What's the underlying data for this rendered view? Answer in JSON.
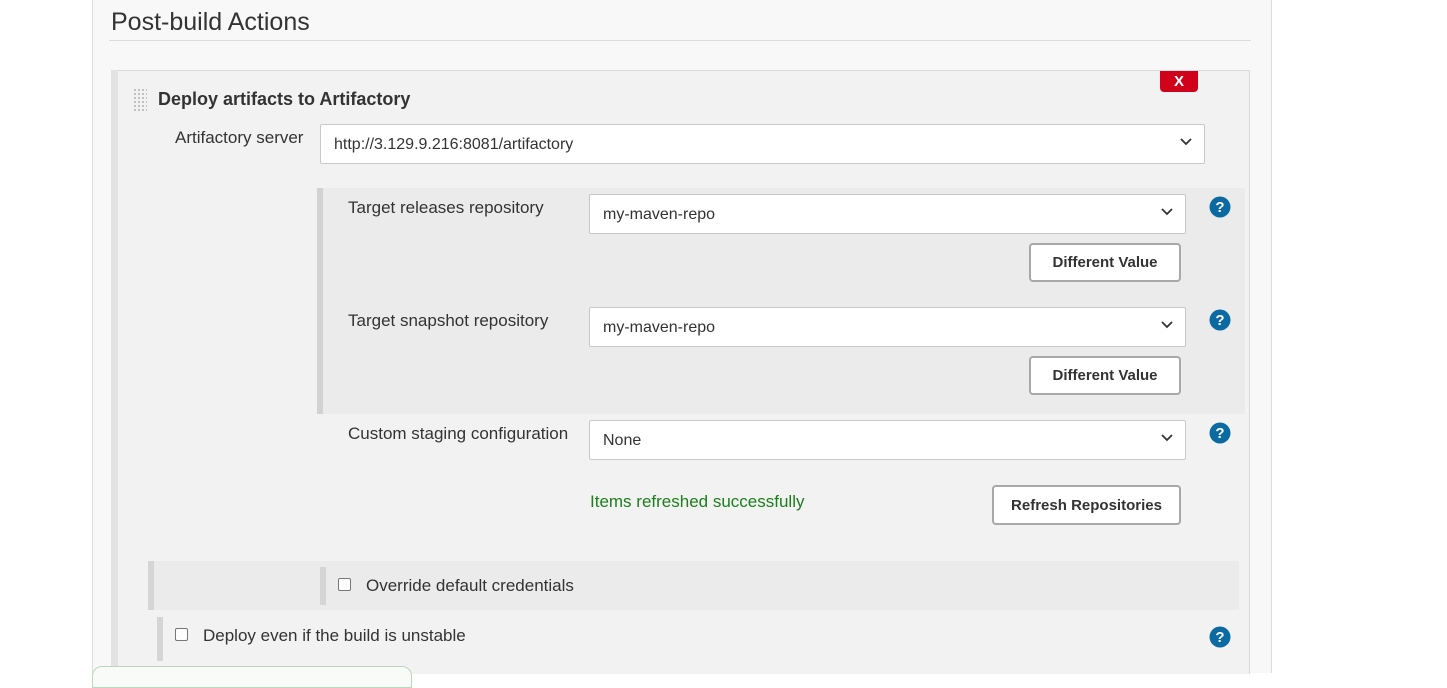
{
  "section": {
    "title": "Post-build Actions"
  },
  "step": {
    "title": "Deploy artifacts to Artifactory",
    "delete_label": "X"
  },
  "server": {
    "label": "Artifactory server",
    "value": "http://3.129.9.216:8081/artifactory"
  },
  "releases": {
    "label": "Target releases repository",
    "value": "my-maven-repo",
    "button": "Different Value"
  },
  "snapshots": {
    "label": "Target snapshot repository",
    "value": "my-maven-repo",
    "button": "Different Value"
  },
  "staging": {
    "label": "Custom staging configuration",
    "value": "None"
  },
  "refresh": {
    "status": "Items refreshed successfully",
    "button": "Refresh Repositories"
  },
  "override_credentials": {
    "label": "Override default credentials",
    "checked": false
  },
  "deploy_unstable": {
    "label": "Deploy even if the build is unstable",
    "checked": false
  },
  "colors": {
    "help_icon": "#0b6aa2",
    "delete_button": "#d0021b",
    "success_text": "#1d7e1d"
  },
  "icons": {
    "help": "help-icon",
    "dropdown": "chevron-down-icon",
    "drag": "drag-handle-icon"
  }
}
